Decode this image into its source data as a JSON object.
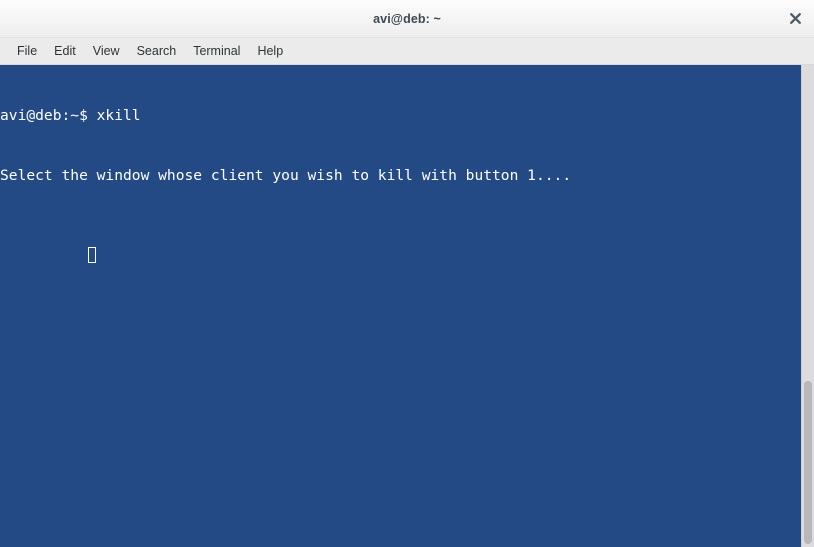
{
  "window": {
    "title": "avi@deb: ~",
    "close_icon": "close-icon"
  },
  "menubar": {
    "items": [
      {
        "label": "File"
      },
      {
        "label": "Edit"
      },
      {
        "label": "View"
      },
      {
        "label": "Search"
      },
      {
        "label": "Terminal"
      },
      {
        "label": "Help"
      }
    ]
  },
  "terminal": {
    "background_color": "#244a85",
    "foreground_color": "#ffffff",
    "lines": [
      "avi@deb:~$ xkill",
      "Select the window whose client you wish to kill with button 1...."
    ],
    "prompt": "avi@deb:~$",
    "command": "xkill",
    "cursor": "block-outline"
  },
  "scrollbar": {
    "orientation": "vertical",
    "thumb_position": "bottom"
  }
}
